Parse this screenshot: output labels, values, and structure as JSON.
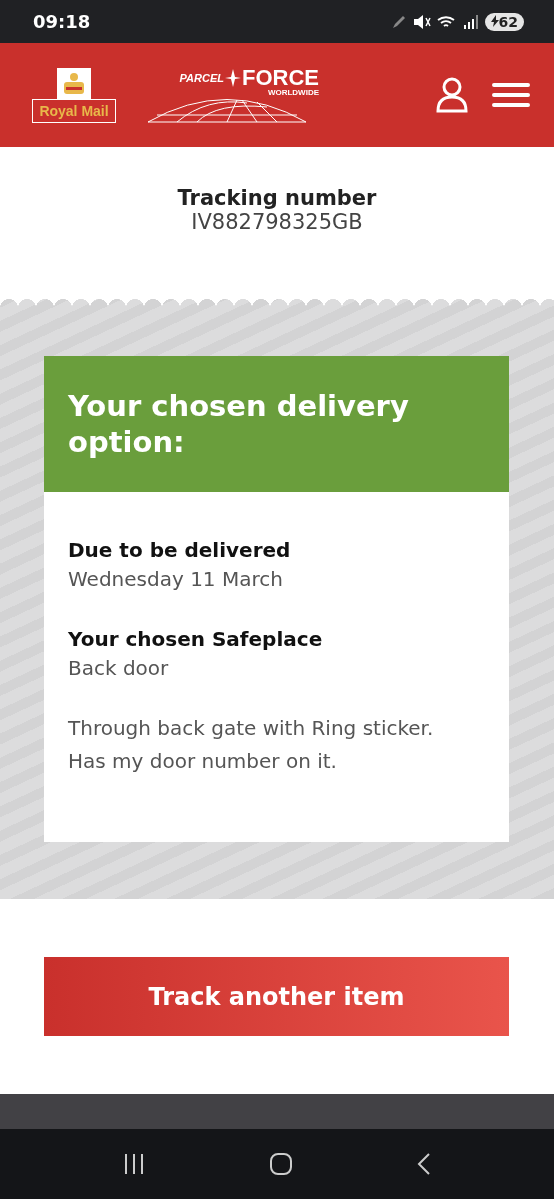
{
  "status_bar": {
    "time": "09:18",
    "battery": "62"
  },
  "header": {
    "royal_mail_logo": "Royal Mail",
    "parcelforce_logo": {
      "word_1": "PARCEL",
      "word_2": "FORCE",
      "tagline": "WORLDWIDE"
    }
  },
  "tracking": {
    "label": "Tracking number",
    "number": "IV882798325GB"
  },
  "delivery_card": {
    "title": "Your chosen delivery option:",
    "sections": [
      {
        "heading": "Due to be delivered",
        "value": "Wednesday 11 March"
      },
      {
        "heading": "Your chosen Safeplace",
        "value": "Back door"
      }
    ],
    "note": "Through back gate with Ring sticker. Has my door number on it."
  },
  "track_button": "Track another item"
}
